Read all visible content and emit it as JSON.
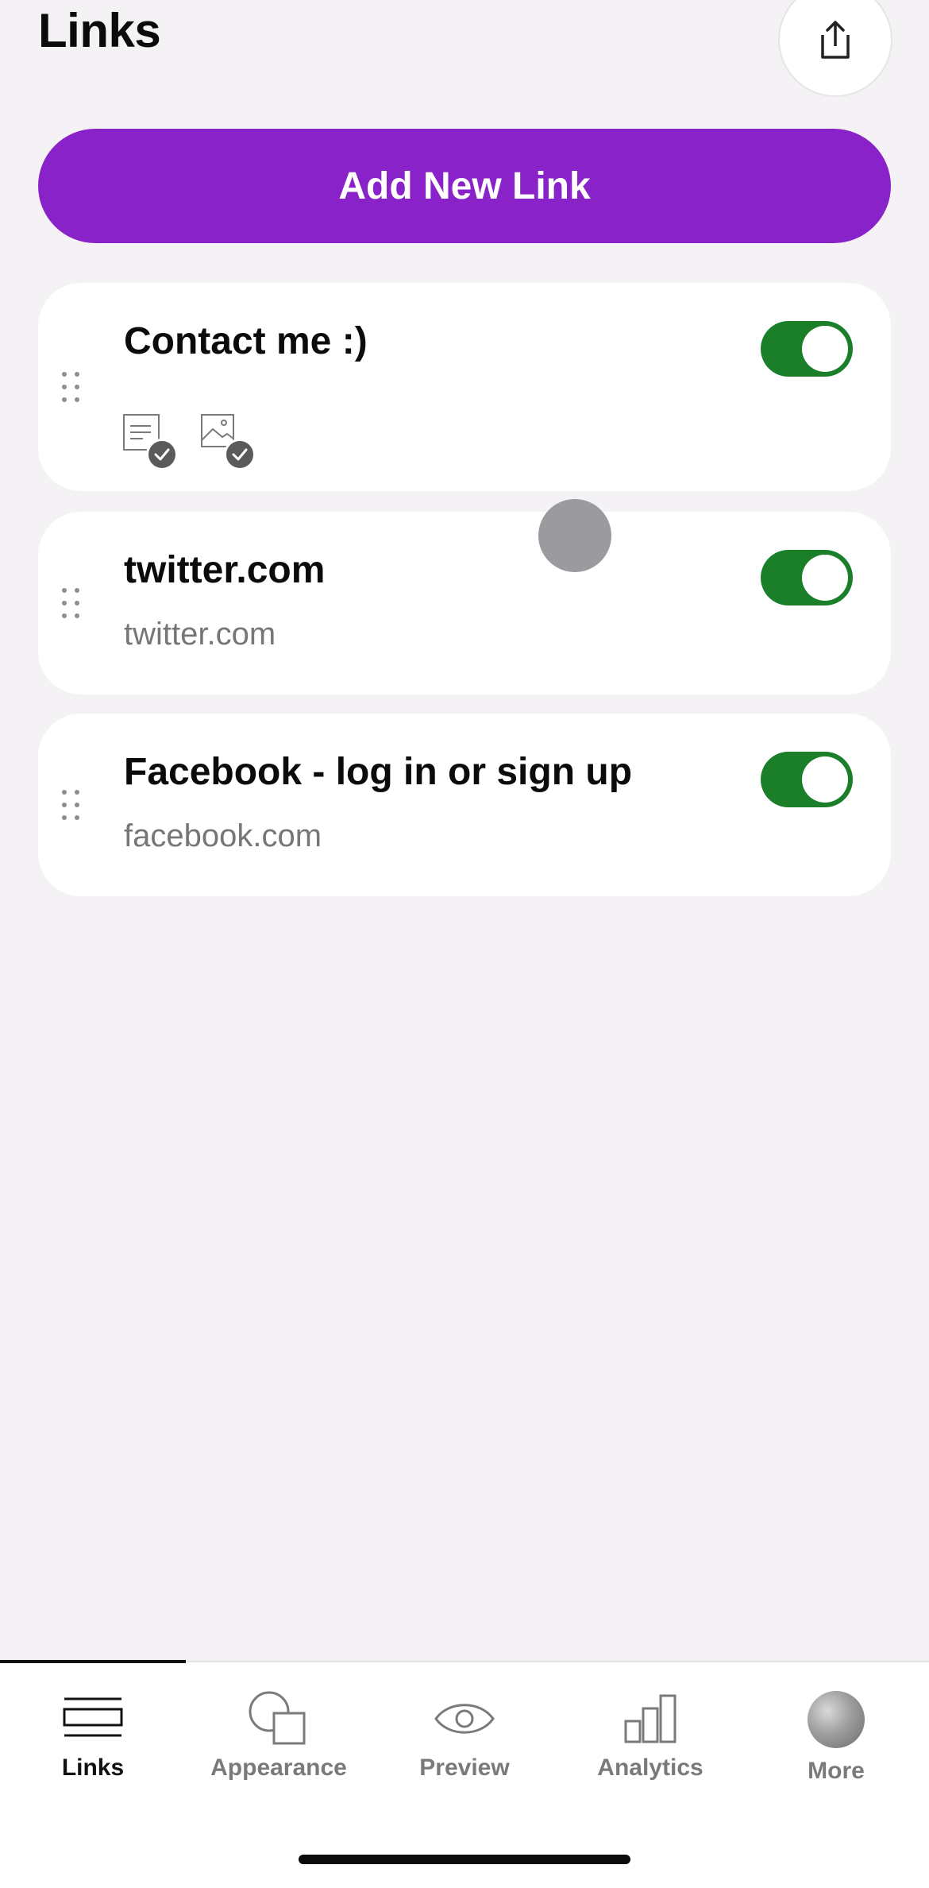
{
  "header": {
    "title": "Links"
  },
  "actions": {
    "add_link_label": "Add New Link"
  },
  "links": [
    {
      "title": "Contact me :)",
      "url": "",
      "enabled": true
    },
    {
      "title": "twitter.com",
      "url": "twitter.com",
      "enabled": true
    },
    {
      "title": "Facebook - log in or sign up",
      "url": "facebook.com",
      "enabled": true
    }
  ],
  "tabs": [
    {
      "label": "Links",
      "icon": "links-icon",
      "active": true
    },
    {
      "label": "Appearance",
      "icon": "appearance-icon",
      "active": false
    },
    {
      "label": "Preview",
      "icon": "eye-icon",
      "active": false
    },
    {
      "label": "Analytics",
      "icon": "bar-chart-icon",
      "active": false
    },
    {
      "label": "More",
      "icon": "avatar",
      "active": false
    }
  ],
  "colors": {
    "accent": "#8a22c9",
    "toggle_on": "#1b7f2a",
    "background": "#f4f2f4"
  }
}
